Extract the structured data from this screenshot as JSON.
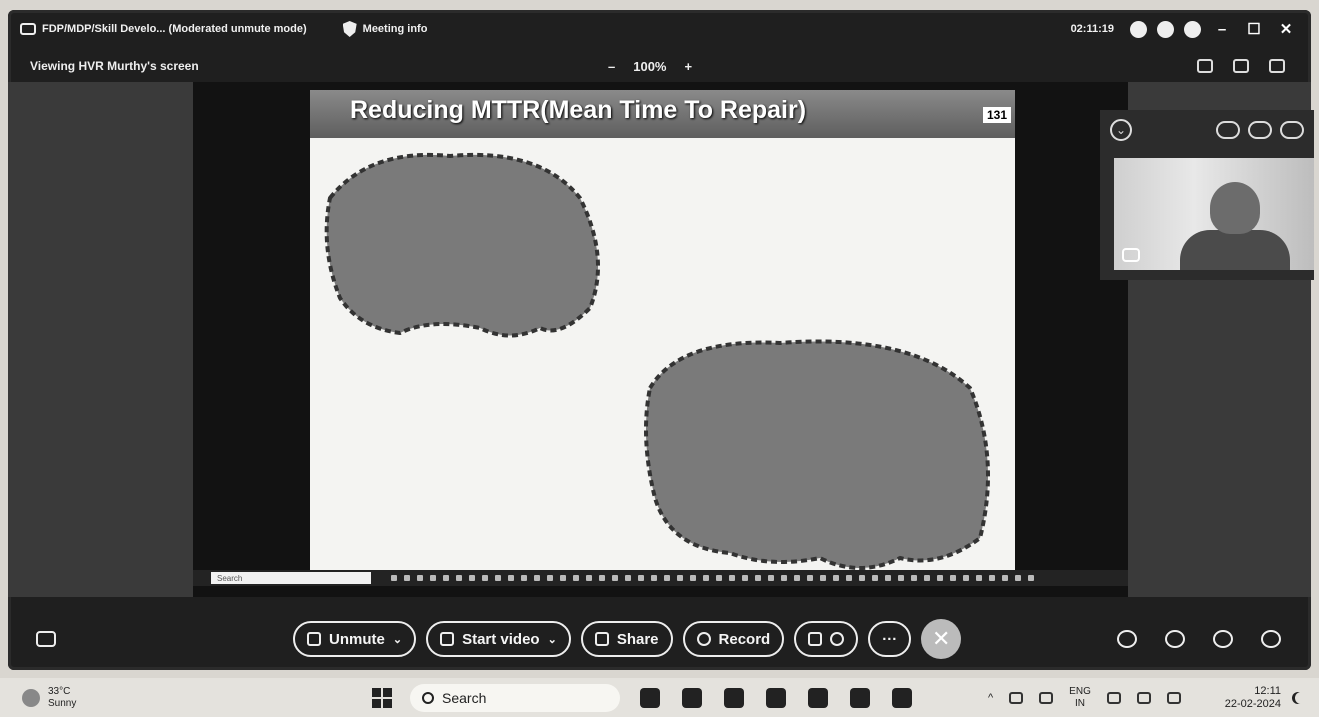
{
  "titlebar": {
    "window_title": "FDP/MDP/Skill Develo... (Moderated unmute mode)",
    "meeting_info": "Meeting info",
    "timer": "02:11:19",
    "minimize": "–",
    "maximize": "☐",
    "close": "✕"
  },
  "viewbar": {
    "viewing": "Viewing HVR Murthy's screen",
    "zoom_out": "–",
    "zoom_level": "100%",
    "zoom_in": "+"
  },
  "slide": {
    "title": "Reducing MTTR(Mean Time To Repair)",
    "page_number": "131"
  },
  "inner_taskbar": {
    "search": "Search"
  },
  "controls": {
    "unmute": "Unmute",
    "start_video": "Start video",
    "share": "Share",
    "record": "Record",
    "end": "✕",
    "more": "···"
  },
  "taskbar": {
    "temperature": "33°C",
    "condition": "Sunny",
    "search": "Search",
    "lang_top": "ENG",
    "lang_bottom": "IN",
    "time": "12:11",
    "date": "22-02-2024"
  },
  "colors": {
    "frame": "#1f1f1f",
    "slide_header": "#6e6e6e",
    "end_button": "#bbbbbb"
  }
}
